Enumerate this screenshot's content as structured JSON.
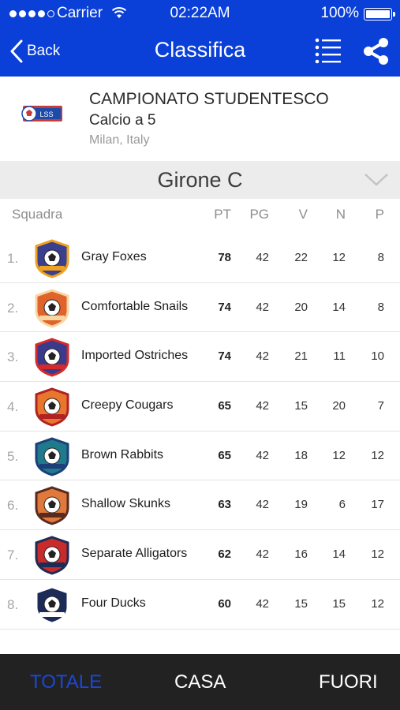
{
  "status_bar": {
    "carrier": "Carrier",
    "time": "02:22AM",
    "battery": "100%"
  },
  "nav": {
    "back_label": "Back",
    "title": "Classifica"
  },
  "championship": {
    "logo_text": "LSS",
    "name": "CAMPIONATO STUDENTESCO",
    "subtitle": "Calcio a 5",
    "location": "Milan, Italy"
  },
  "group": {
    "label": "Girone C"
  },
  "table": {
    "headers": {
      "team": "Squadra",
      "pt": "PT",
      "pg": "PG",
      "v": "V",
      "n": "N",
      "p": "P"
    },
    "rows": [
      {
        "pos": "1.",
        "team": "Gray Foxes",
        "pt": "78",
        "pg": "42",
        "v": "22",
        "n": "12",
        "p": "8",
        "badge_color": "#3a3f8f",
        "badge_accent": "#f0a11e"
      },
      {
        "pos": "2.",
        "team": "Comfortable Snails",
        "pt": "74",
        "pg": "42",
        "v": "20",
        "n": "14",
        "p": "8",
        "badge_color": "#e0632b",
        "badge_accent": "#f7d6a2"
      },
      {
        "pos": "3.",
        "team": "Imported Ostriches",
        "pt": "74",
        "pg": "42",
        "v": "21",
        "n": "11",
        "p": "10",
        "badge_color": "#3a3a8c",
        "badge_accent": "#d62a2a"
      },
      {
        "pos": "4.",
        "team": "Creepy Cougars",
        "pt": "65",
        "pg": "42",
        "v": "15",
        "n": "20",
        "p": "7",
        "badge_color": "#e8762d",
        "badge_accent": "#b12222"
      },
      {
        "pos": "5.",
        "team": "Brown Rabbits",
        "pt": "65",
        "pg": "42",
        "v": "18",
        "n": "12",
        "p": "12",
        "badge_color": "#1f7a8c",
        "badge_accent": "#1c3f7a"
      },
      {
        "pos": "6.",
        "team": "Shallow Skunks",
        "pt": "63",
        "pg": "42",
        "v": "19",
        "n": "6",
        "p": "17",
        "badge_color": "#e07a3c",
        "badge_accent": "#5a2a1e"
      },
      {
        "pos": "7.",
        "team": "Separate Alligators",
        "pt": "62",
        "pg": "42",
        "v": "16",
        "n": "14",
        "p": "12",
        "badge_color": "#c92a2a",
        "badge_accent": "#1d2b57"
      },
      {
        "pos": "8.",
        "team": "Four Ducks",
        "pt": "60",
        "pg": "42",
        "v": "15",
        "n": "15",
        "p": "12",
        "badge_color": "#1d2b57",
        "badge_accent": "#ffffff"
      }
    ]
  },
  "tabs": {
    "totale": "TOTALE",
    "casa": "CASA",
    "fuori": "FUORI",
    "active": "totale"
  },
  "colors": {
    "brand_blue": "#0a3fd8",
    "tab_bar": "#222222",
    "active_tab": "#1a47d6",
    "group_bg": "#ececec"
  },
  "icons": {
    "back": "chevron-left-icon",
    "list": "list-icon",
    "share": "share-icon",
    "expand": "chevron-down-icon",
    "wifi": "wifi-icon",
    "battery": "battery-icon"
  }
}
